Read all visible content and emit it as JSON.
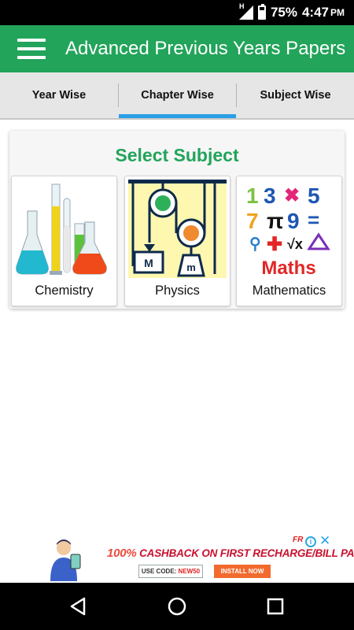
{
  "status_bar": {
    "network_label": "H",
    "battery": "75%",
    "time": "4:47",
    "ampm": "PM"
  },
  "app_bar": {
    "title": "Advanced Previous Years Papers",
    "menu_icon": "hamburger-menu-icon"
  },
  "tabs": [
    {
      "label": "Year Wise",
      "selected": false
    },
    {
      "label": "Chapter Wise",
      "selected": true
    },
    {
      "label": "Subject Wise",
      "selected": false
    }
  ],
  "colors": {
    "primary": "#22a45a",
    "tab_indicator": "#2a9fe6",
    "tab_background": "#e6e6e6"
  },
  "card": {
    "title": "Select Subject",
    "subjects": [
      {
        "name": "Chemistry",
        "image": "lab-flasks-image"
      },
      {
        "name": "Physics",
        "image": "pulley-system-image"
      },
      {
        "name": "Mathematics",
        "image": "math-symbols-image"
      }
    ],
    "math_image_text": "Maths"
  },
  "ad": {
    "headline_percent": "100%",
    "headline_rest": " CASHBACK ON FIRST RECHARGE/BILL PAY!",
    "code_label": "USE CODE: ",
    "code_value": "NEW50",
    "install_label": "INSTALL NOW",
    "brand": "FR"
  },
  "nav_bar": {
    "icons": [
      "back-icon",
      "home-icon",
      "recents-icon"
    ]
  }
}
